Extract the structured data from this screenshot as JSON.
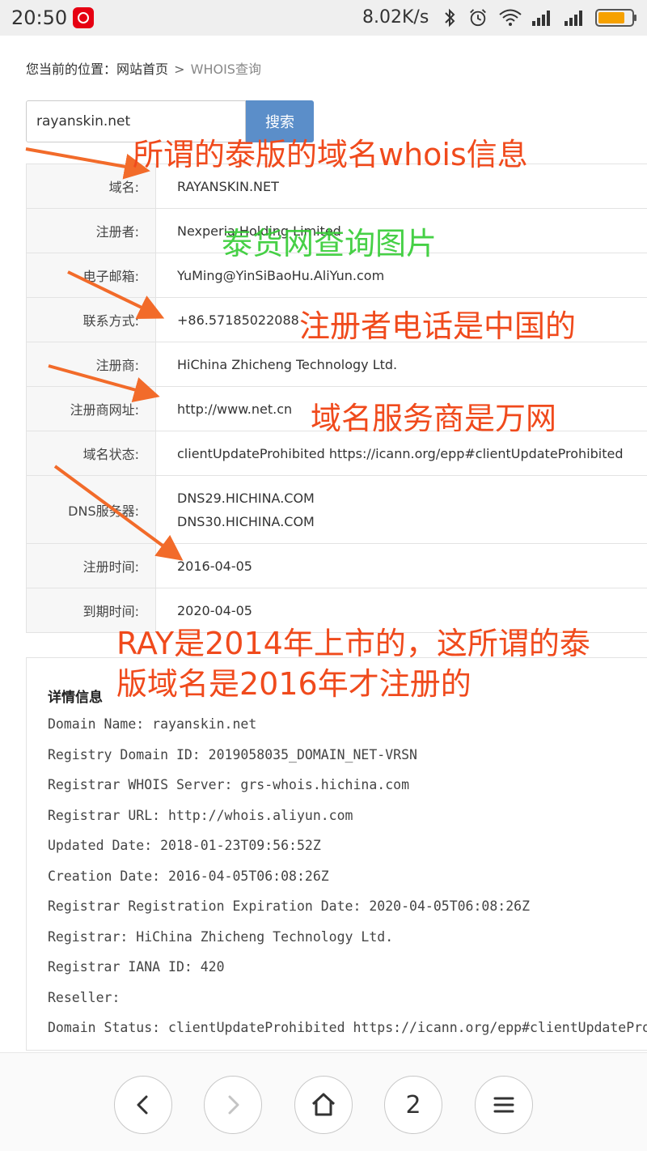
{
  "status_bar": {
    "time": "20:50",
    "network_speed": "8.02K/s",
    "icons": [
      "netease-music-icon",
      "bluetooth-icon",
      "alarm-icon",
      "wifi-icon",
      "signal-icon",
      "signal-icon",
      "battery-icon"
    ]
  },
  "breadcrumb": {
    "prefix": "您当前的位置：",
    "home": "网站首页",
    "separator": ">",
    "current": "WHOIS查询"
  },
  "search": {
    "value": "rayanskin.net",
    "button_label": "搜索"
  },
  "whois_table": [
    {
      "label": "域名:",
      "value": "RAYANSKIN.NET"
    },
    {
      "label": "注册者:",
      "value": "Nexperia Holding Limited"
    },
    {
      "label": "电子邮箱:",
      "value": "YuMing@YinSiBaoHu.AliYun.com"
    },
    {
      "label": "联系方式:",
      "value": "+86.57185022088"
    },
    {
      "label": "注册商:",
      "value": "HiChina Zhicheng Technology Ltd."
    },
    {
      "label": "注册商网址:",
      "value": "http://www.net.cn"
    },
    {
      "label": "域名状态:",
      "value": "clientUpdateProhibited https://icann.org/epp#clientUpdateProhibited"
    },
    {
      "label": "DNS服务器:",
      "values": [
        "DNS29.HICHINA.COM",
        "DNS30.HICHINA.COM"
      ]
    },
    {
      "label": "注册时间:",
      "value": "2016-04-05"
    },
    {
      "label": "到期时间:",
      "value": "2020-04-05"
    }
  ],
  "details": {
    "title": "详情信息",
    "lines": [
      "Domain Name: rayanskin.net",
      "Registry Domain ID: 2019058035_DOMAIN_NET-VRSN",
      "Registrar WHOIS Server: grs-whois.hichina.com",
      "Registrar URL: http://whois.aliyun.com",
      "Updated Date: 2018-01-23T09:56:52Z",
      "Creation Date: 2016-04-05T06:08:26Z",
      "Registrar Registration Expiration Date: 2020-04-05T06:08:26Z",
      "Registrar: HiChina Zhicheng Technology Ltd.",
      "Registrar IANA ID: 420",
      "Reseller:",
      "Domain Status: clientUpdateProhibited https://icann.org/epp#clientUpdateProhibited"
    ]
  },
  "annotations": {
    "whois_note": "所谓的泰版的域名whois信息",
    "watermark": "泰货网查询图片",
    "phone_note": "注册者电话是中国的",
    "registrar_note": "域名服务商是万网",
    "date_note": "RAY是2014年上市的，这所谓的泰版域名是2016年才注册的",
    "colors": {
      "red": "#f04a1c",
      "green": "#33cc33",
      "arrow": "#f26b2a"
    }
  },
  "bottom_nav": {
    "buttons": [
      "back-icon",
      "forward-icon",
      "home-icon",
      "tabs",
      "menu-icon"
    ],
    "tab_count": "2"
  }
}
